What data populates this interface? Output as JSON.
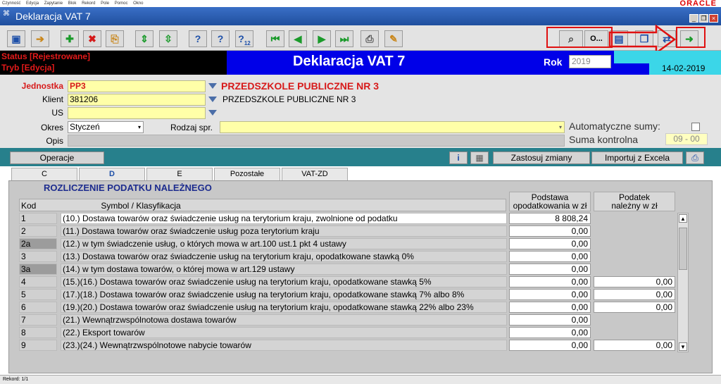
{
  "menu": [
    "Czynność",
    "Edycja",
    "Zapytanie",
    "Blok",
    "Rekord",
    "Pole",
    "Pomoc",
    "Okno"
  ],
  "oracle": "ORACLE",
  "window": {
    "title": "Deklaracja VAT 7",
    "sys_icon": "⌘"
  },
  "toolbar": {
    "o_label": "O...",
    "sub_12": "12"
  },
  "header": {
    "status": "Status [Rejestrowane]",
    "tryb": "Tryb [Edycja]",
    "title": "Deklaracja VAT 7",
    "rok_label": "Rok",
    "rok_value": "2019",
    "date": "14-02-2019"
  },
  "form": {
    "jednostka_label": "Jednostka",
    "jednostka_value": "PP3",
    "jednostka_name": "PRZEDSZKOLE PUBLICZNE NR 3",
    "klient_label": "Klient",
    "klient_value": "381206",
    "klient_name": "PRZEDSZKOLE PUBLICZNE NR 3",
    "us_label": "US",
    "us_value": "",
    "okres_label": "Okres",
    "okres_value": "Styczeń",
    "rodzaj_label": "Rodzaj spr.",
    "rodzaj_value": "",
    "opis_label": "Opis",
    "opis_value": "",
    "auto_label": "Automatyczne sumy:",
    "suma_label": "Suma kontrolna",
    "suma_value": "09 - 00"
  },
  "actions": {
    "operacje": "Operacje",
    "zastosuj": "Zastosuj zmiany",
    "importuj": "Importuj z Excela",
    "info_icon": "i"
  },
  "tabs": [
    "C",
    "D",
    "E",
    "Pozostałe",
    "VAT-ZD"
  ],
  "section": {
    "title": "ROZLICZENIE PODATKU NALEŻNEGO",
    "col_kod": "Kod",
    "col_symbol": "Symbol / Klasyfikacja",
    "col_podstawa_1": "Podstawa",
    "col_podstawa_2": "opodatkowania w zł",
    "col_podatek_1": "Podatek",
    "col_podatek_2": "należny w zł"
  },
  "rows": [
    {
      "kod": "1",
      "desc": "(10.) Dostawa towarów oraz świadczenie usług na terytorium kraju, zwolnione od podatku",
      "val": "8 808,24",
      "val2": null
    },
    {
      "kod": "2",
      "desc": "(11.) Dostawa towarów oraz świadczenie usług poza terytorium kraju",
      "val": "0,00",
      "val2": null
    },
    {
      "kod": "2a",
      "desc": "(12.) w tym świadczenie usług, o których mowa w art.100 ust.1 pkt 4 ustawy",
      "val": "0,00",
      "val2": null
    },
    {
      "kod": "3",
      "desc": "(13.) Dostawa towarów oraz świadczenie usług na terytorium kraju, opodatkowane stawką 0%",
      "val": "0,00",
      "val2": null
    },
    {
      "kod": "3a",
      "desc": "(14.) w tym dostawa towarów, o której mowa w art.129 ustawy",
      "val": "0,00",
      "val2": null
    },
    {
      "kod": "4",
      "desc": "(15.)(16.) Dostawa towarów oraz świadczenie usług na terytorium kraju, opodatkowane stawką 5%",
      "val": "0,00",
      "val2": "0,00"
    },
    {
      "kod": "5",
      "desc": "(17.)(18.) Dostawa towarów oraz świadczenie usług na terytorium kraju, opodatkowane stawką 7% albo 8%",
      "val": "0,00",
      "val2": "0,00"
    },
    {
      "kod": "6",
      "desc": "(19.)(20.) Dostawa towarów oraz świadczenie usług na terytorium kraju, opodatkowane stawką 22% albo 23%",
      "val": "0,00",
      "val2": "0,00"
    },
    {
      "kod": "7",
      "desc": "(21.) Wewnątrzwspólnotowa dostawa towarów",
      "val": "0,00",
      "val2": null
    },
    {
      "kod": "8",
      "desc": "(22.) Eksport towarów",
      "val": "0,00",
      "val2": null
    },
    {
      "kod": "9",
      "desc": "(23.)(24.) Wewnątrzwspólnotowe nabycie towarów",
      "val": "0,00",
      "val2": "0,00"
    }
  ],
  "statusbar": "Rekord: 1/1",
  "colors": {
    "status_red": "#e41a1a",
    "title_bar": "#0000e8",
    "teal_bar": "#27808c",
    "cyan": "#3bd6e8",
    "field_yellow": "#ffffa8",
    "highlight_red": "#e01010"
  }
}
